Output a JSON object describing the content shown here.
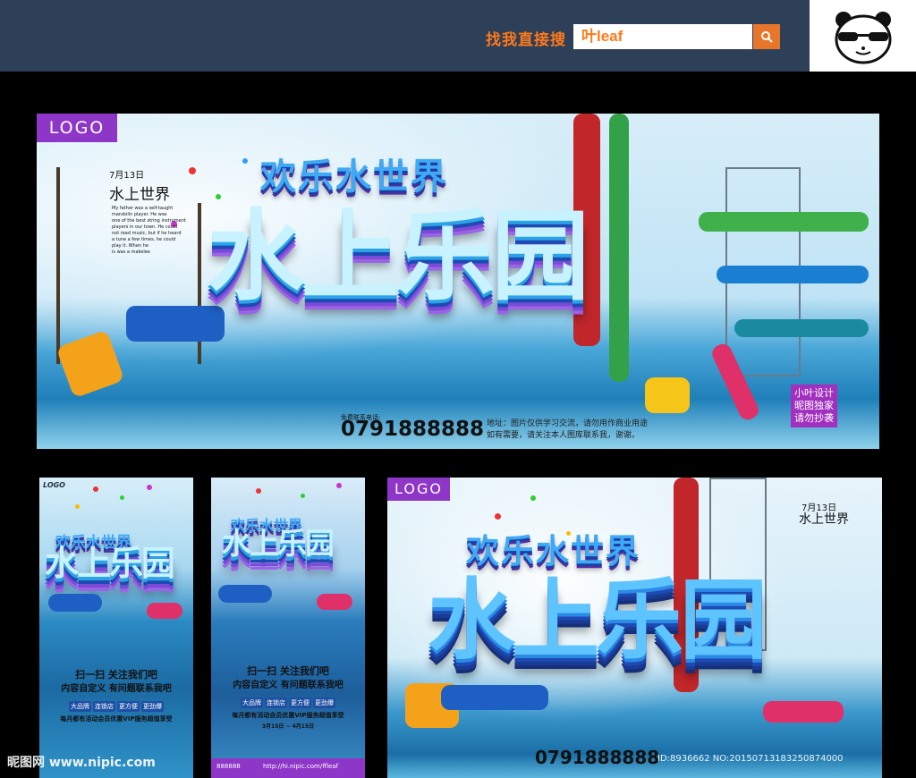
{
  "search": {
    "label": "找我直接搜",
    "value": "叶leaf"
  },
  "banner_main": {
    "logo": "LOGO",
    "date": "7月13日",
    "subtitle": "水上世界",
    "body_lines": [
      "My father was a self-taught",
      "mandolin player. He was",
      "one of the best string instrument",
      "players in our town. He could",
      "not read music, but if he heard",
      "a tune a few times, he could",
      "play it. When he",
      "is was a makelee"
    ],
    "title_small": "欢乐水世界",
    "title_big": "水上乐园",
    "phone_label": "免费联系电话:",
    "phone": "0791888888",
    "address_line1": "地址：图片仅供学习交流，请勿用作商业用途",
    "address_line2": "如有需要，请关注本人图库联系我，谢谢。",
    "tag_lines": [
      "小叶设计",
      "昵图独家",
      "请勿抄袭"
    ]
  },
  "poster_1": {
    "logo": "LOGO",
    "title_small": "欢乐水世界",
    "title_big": "水上乐园",
    "qr_line1": "扫一扫 关注我们吧",
    "qr_line2": "内容自定义 有问题联系我吧",
    "chips": [
      "大品牌",
      "连锁店",
      "更方便",
      "更劲爆"
    ],
    "promo": "每月都有活动会员优惠VIP服务超值享受"
  },
  "poster_2": {
    "title_small": "欢乐水世界",
    "title_big": "水上乐园",
    "qr_line1": "扫一扫 关注我们吧",
    "qr_line2": "内容自定义 有问题联系我吧",
    "chips": [
      "大品牌",
      "连锁店",
      "更方便",
      "更劲爆"
    ],
    "promo": "每月都有活动会员优惠VIP服务超值享受",
    "dates": "3月15日 ~ 4月15日",
    "phone": "888888",
    "url": "http://hi.nipic.com/ffleaf"
  },
  "banner_second": {
    "logo": "LOGO",
    "date": "7月13日",
    "subtitle": "水上世界",
    "title_small": "欢乐水世界",
    "title_big": "水上乐园",
    "phone": "0791888888"
  },
  "watermark": {
    "left": "昵图网 www.nipic.com",
    "right": "ID:8936662 NO:20150713183250874000"
  },
  "colors": {
    "topbar": "#2e3f58",
    "accent": "#ff7a1a",
    "purple": "#8e36c8",
    "title_blue": "#3fa9f5"
  }
}
